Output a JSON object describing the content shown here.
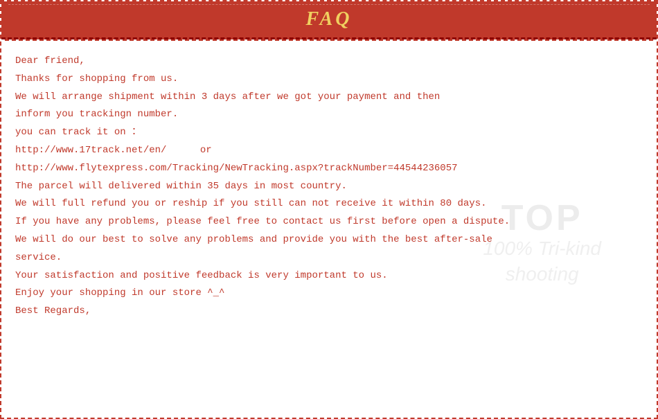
{
  "header": {
    "title": "FAQ"
  },
  "content": {
    "line1": "Dear friend,",
    "line2": "Thanks for shopping from us.",
    "line3": "We will arrange shipment within 3 days after we got your payment and then",
    "line4": "inform you trackingn number.",
    "line5": "you can track it on ：",
    "line6a": "http://www.17track.net/en/",
    "line6b": "or",
    "line7": "http://www.flytexpress.com/Tracking/NewTracking.aspx?trackNumber=44544236057",
    "line8": "The parcel will delivered within 35 days in most country.",
    "line9": "We will full refund you or reship if you still can not receive it within 80 days.",
    "line10": "If you have any problems, please feel free to contact us first before open a dispute.",
    "line11": "We will do our best to solve any problems and provide you with the best after-sale",
    "line12": "service.",
    "line13": "Your satisfaction and positive feedback is very important to us.",
    "line14": "Enjoy your shopping in our store ^_^",
    "line15": "Best Regards,"
  },
  "watermark": {
    "top": "TOP",
    "bottom1": "100% Tri-kind",
    "bottom2": "shooting"
  }
}
